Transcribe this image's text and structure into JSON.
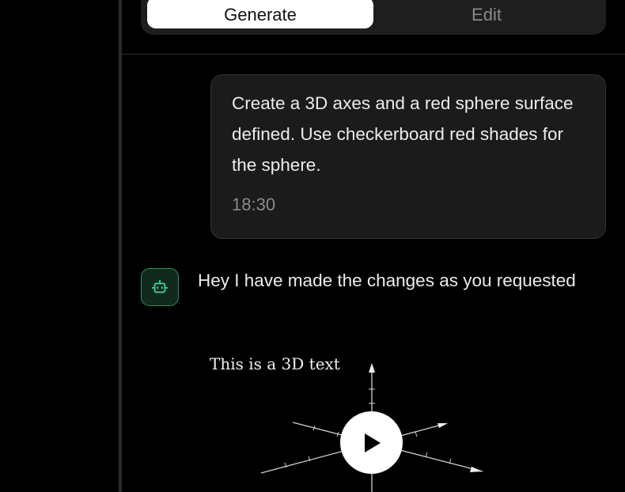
{
  "mode_toggle": {
    "generate_label": "Generate",
    "edit_label": "Edit",
    "active": "Generate"
  },
  "user_message": {
    "text": "Create a 3D axes and a red sphere surface defined. Use checkerboard red shades for the sphere.",
    "time": "18:30"
  },
  "bot_message": {
    "icon": "robot-icon",
    "text": "Hey I have made the changes as you requested",
    "preview": {
      "scene_text": "This is a 3D text",
      "play_icon": "play-icon"
    }
  },
  "colors": {
    "background": "#000000",
    "bubble": "#1b1b1b",
    "bot_accent": "#3ecf8e"
  }
}
